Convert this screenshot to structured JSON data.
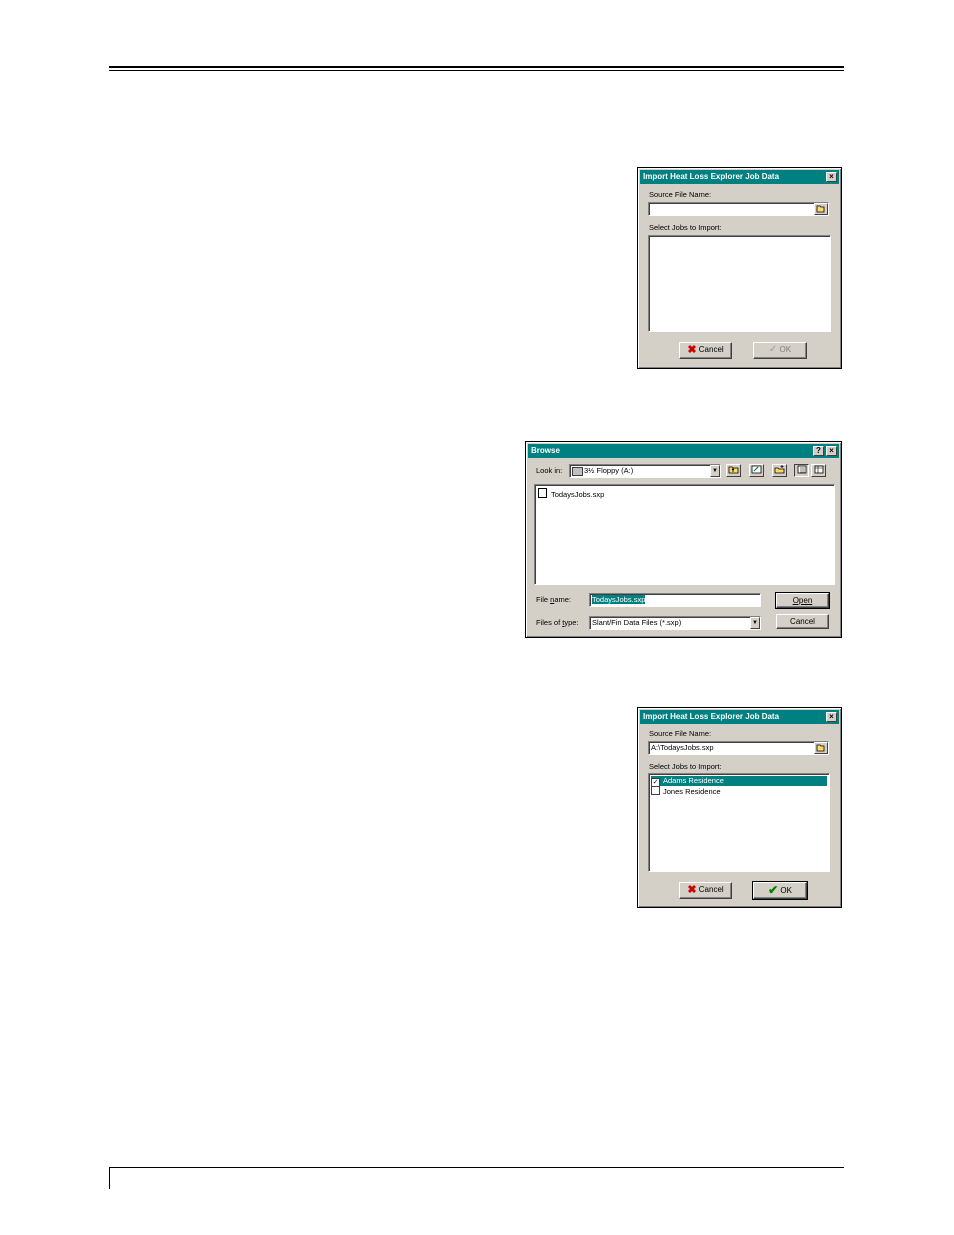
{
  "dialog_import_empty": {
    "title": "Import Heat Loss Explorer Job Data",
    "close_glyph": "×",
    "source_label": "Source File Name:",
    "source_value": "",
    "jobs_label": "Select Jobs to Import:",
    "cancel_label": "Cancel",
    "ok_label": "OK"
  },
  "dialog_browse": {
    "title": "Browse",
    "help_glyph": "?",
    "close_glyph": "×",
    "lookin_label": "Look in:",
    "lookin_value": "3½ Floppy (A:)",
    "files": [
      {
        "name": "TodaysJobs.sxp",
        "icon": "file-icon"
      }
    ],
    "filename_label": "File name:",
    "filename_value": "TodaysJobs.sxp",
    "filetype_label": "Files of type:",
    "filetype_value": "Slant/Fin Data Files (*.sxp)",
    "open_label": "Open",
    "cancel_label": "Cancel"
  },
  "dialog_import_filled": {
    "title": "Import Heat Loss Explorer Job Data",
    "close_glyph": "×",
    "source_label": "Source File Name:",
    "source_value": "A:\\TodaysJobs.sxp",
    "jobs_label": "Select Jobs to Import:",
    "jobs": [
      {
        "name": "Adams Residence",
        "checked": true
      },
      {
        "name": "Jones Residence",
        "checked": false
      }
    ],
    "cancel_label": "Cancel",
    "ok_label": "OK"
  },
  "colors": {
    "titlebar": "#008080",
    "dialog_face": "#d4d0c8",
    "cancel_x": "#cc0000",
    "ok_check": "#008000"
  }
}
